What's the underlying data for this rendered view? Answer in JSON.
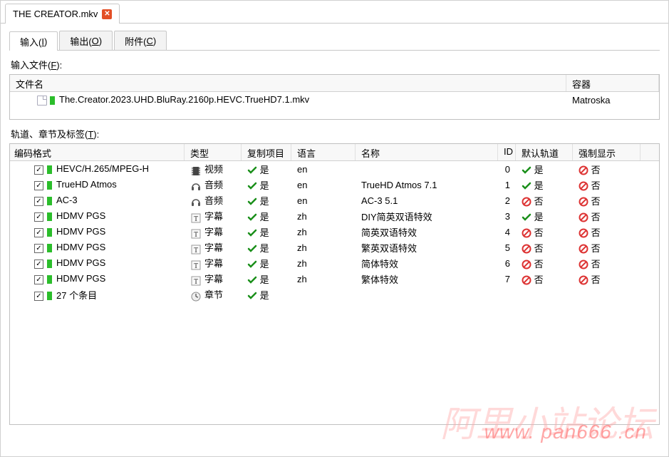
{
  "file_tab": {
    "title": "THE CREATOR.mkv"
  },
  "tabs": {
    "input": {
      "pre": "输入(",
      "hot": "I",
      "post": ")"
    },
    "output": {
      "pre": "输出(",
      "hot": "O",
      "post": ")"
    },
    "attach": {
      "pre": "附件(",
      "hot": "C",
      "post": ")"
    }
  },
  "input_files": {
    "label_pre": "输入文件(",
    "label_hot": "F",
    "label_post": "):",
    "headers": {
      "filename": "文件名",
      "container": "容器"
    },
    "rows": [
      {
        "name": "The.Creator.2023.UHD.BluRay.2160p.HEVC.TrueHD7.1.mkv",
        "container": "Matroska"
      }
    ]
  },
  "tracks": {
    "label_pre": "轨道、章节及标签(",
    "label_hot": "T",
    "label_post": "):",
    "headers": {
      "codec": "编码格式",
      "type": "类型",
      "copy": "复制项目",
      "lang": "语言",
      "name": "名称",
      "id": "ID",
      "def": "默认轨道",
      "force": "强制显示"
    },
    "yes": "是",
    "no": "否",
    "type_video": "视频",
    "type_audio": "音频",
    "type_sub": "字幕",
    "type_chap": "章节",
    "rows": [
      {
        "codec": "HEVC/H.265/MPEG-H",
        "type": "video",
        "copy": true,
        "lang": "en",
        "name": "",
        "id": "0",
        "def": true,
        "force": false
      },
      {
        "codec": "TrueHD Atmos",
        "type": "audio",
        "copy": true,
        "lang": "en",
        "name": "TrueHD Atmos 7.1",
        "id": "1",
        "def": true,
        "force": false
      },
      {
        "codec": "AC-3",
        "type": "audio",
        "copy": true,
        "lang": "en",
        "name": "AC-3 5.1",
        "id": "2",
        "def": false,
        "force": false
      },
      {
        "codec": "HDMV PGS",
        "type": "sub",
        "copy": true,
        "lang": "zh",
        "name": "DIY简英双语特效",
        "id": "3",
        "def": true,
        "force": false
      },
      {
        "codec": "HDMV PGS",
        "type": "sub",
        "copy": true,
        "lang": "zh",
        "name": "简英双语特效",
        "id": "4",
        "def": false,
        "force": false
      },
      {
        "codec": "HDMV PGS",
        "type": "sub",
        "copy": true,
        "lang": "zh",
        "name": "繁英双语特效",
        "id": "5",
        "def": false,
        "force": false
      },
      {
        "codec": "HDMV PGS",
        "type": "sub",
        "copy": true,
        "lang": "zh",
        "name": "简体特效",
        "id": "6",
        "def": false,
        "force": false
      },
      {
        "codec": "HDMV PGS",
        "type": "sub",
        "copy": true,
        "lang": "zh",
        "name": "繁体特效",
        "id": "7",
        "def": false,
        "force": false
      },
      {
        "codec": "27 个条目",
        "type": "chap",
        "copy": true,
        "lang": "",
        "name": "",
        "id": "",
        "def": null,
        "force": null
      }
    ]
  },
  "watermark": {
    "text": "阿里小站论坛",
    "url": "www. pan666 .cn"
  }
}
